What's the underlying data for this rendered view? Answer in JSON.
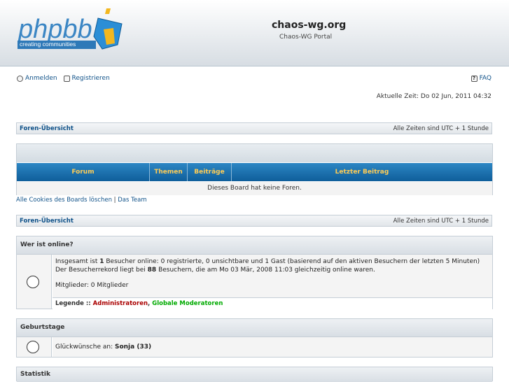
{
  "header": {
    "logo_main": "phpbb",
    "logo_tagline": "creating communities",
    "site_title": "chaos-wg.org",
    "site_description": "Chaos-WG Portal"
  },
  "toplinks": {
    "login": "Anmelden",
    "register": "Registrieren",
    "faq": "FAQ"
  },
  "current_time": "Aktuelle Zeit: Do 02 Jun, 2011 04:32",
  "navbar": {
    "index_link": "Foren-Übersicht",
    "timezone": "Alle Zeiten sind UTC + 1 Stunde"
  },
  "forum_table": {
    "columns": [
      "Forum",
      "Themen",
      "Beiträge",
      "Letzter Beitrag"
    ],
    "empty_message": "Dieses Board hat keine Foren."
  },
  "links_row": {
    "delete_cookies": "Alle Cookies des Boards löschen",
    "separator": " | ",
    "team": "Das Team"
  },
  "who_is_online": {
    "title": "Wer ist online?",
    "line1_pre": "Insgesamt ist ",
    "line1_count": "1",
    "line1_post": " Besucher online: 0 registrierte, 0 unsichtbare und 1 Gast (basierend auf den aktiven Besuchern der letzten 5 Minuten)",
    "line2_pre": "Der Besucherrekord liegt bei ",
    "line2_count": "88",
    "line2_post": " Besuchern, die am Mo 03 Mär, 2008 11:03 gleichzeitig online waren.",
    "members": "Mitglieder: 0 Mitglieder",
    "legend_label": "Legende :: ",
    "legend_admins": "Administratoren",
    "legend_sep": ", ",
    "legend_gmods": "Globale Moderatoren",
    "admin_color": "#aa0000",
    "gmod_color": "#00aa00"
  },
  "birthdays": {
    "title": "Geburtstage",
    "text_pre": "Glückwünsche an: ",
    "name": "Sonja (33)"
  },
  "statistics": {
    "title": "Statistik"
  },
  "colors": {
    "link": "#105289",
    "table_header_start": "#2c86c4",
    "table_header_end": "#0f5e9a",
    "table_header_text": "#ffcc55"
  }
}
